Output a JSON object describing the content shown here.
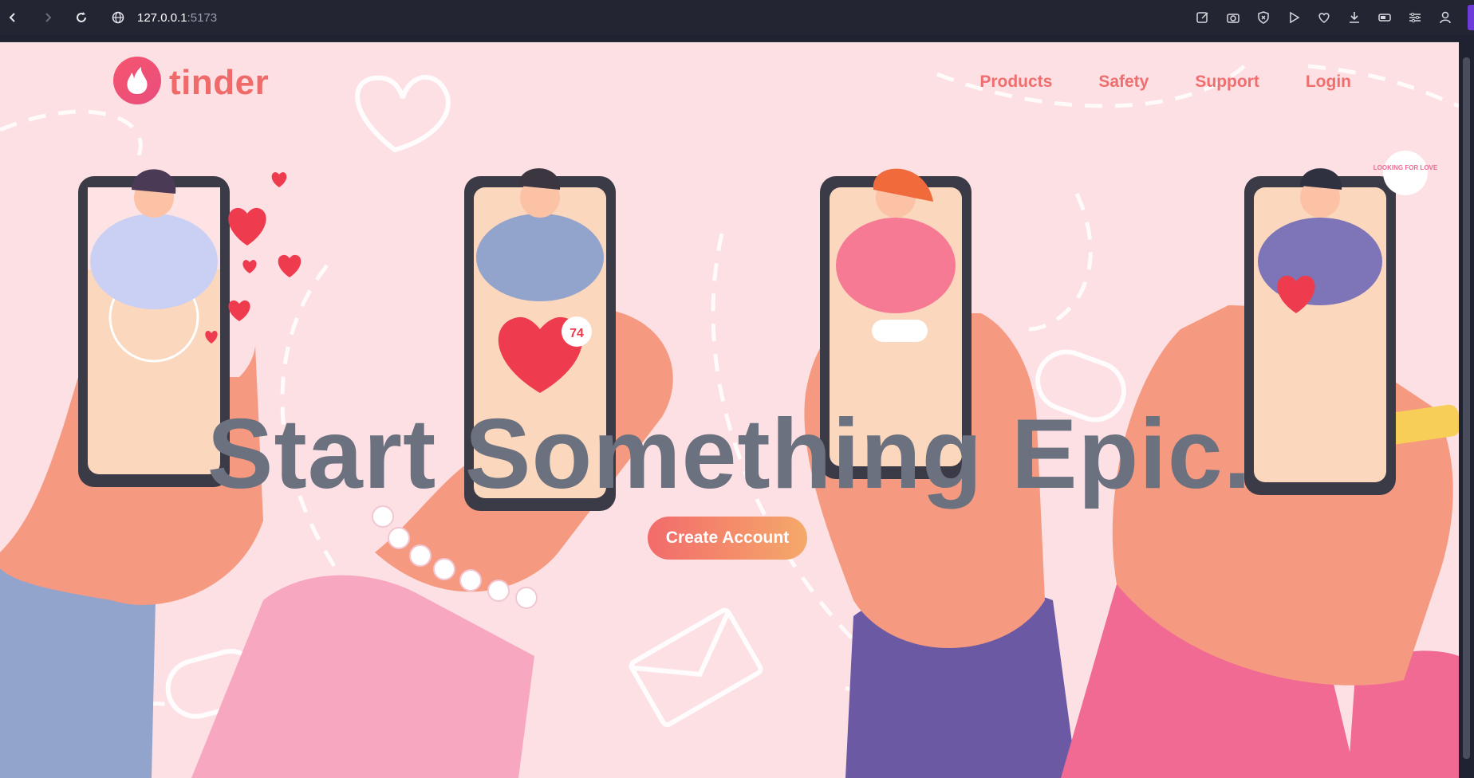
{
  "browser": {
    "url_host": "127.0.0.1",
    "url_port": ":5173"
  },
  "brand": {
    "name": "tinder",
    "color": "#f06a6a"
  },
  "nav": {
    "items": [
      {
        "label": "Products"
      },
      {
        "label": "Safety"
      },
      {
        "label": "Support"
      },
      {
        "label": "Login"
      }
    ]
  },
  "hero": {
    "headline": "Start Something Epic.",
    "cta_label": "Create Account",
    "badge_count": "74",
    "sign_text": "LOOKING FOR LOVE"
  },
  "colors": {
    "background": "#fde0e4",
    "headline": "#6b717f",
    "cta_start": "#f26b6b",
    "cta_end": "#f5a96a"
  }
}
